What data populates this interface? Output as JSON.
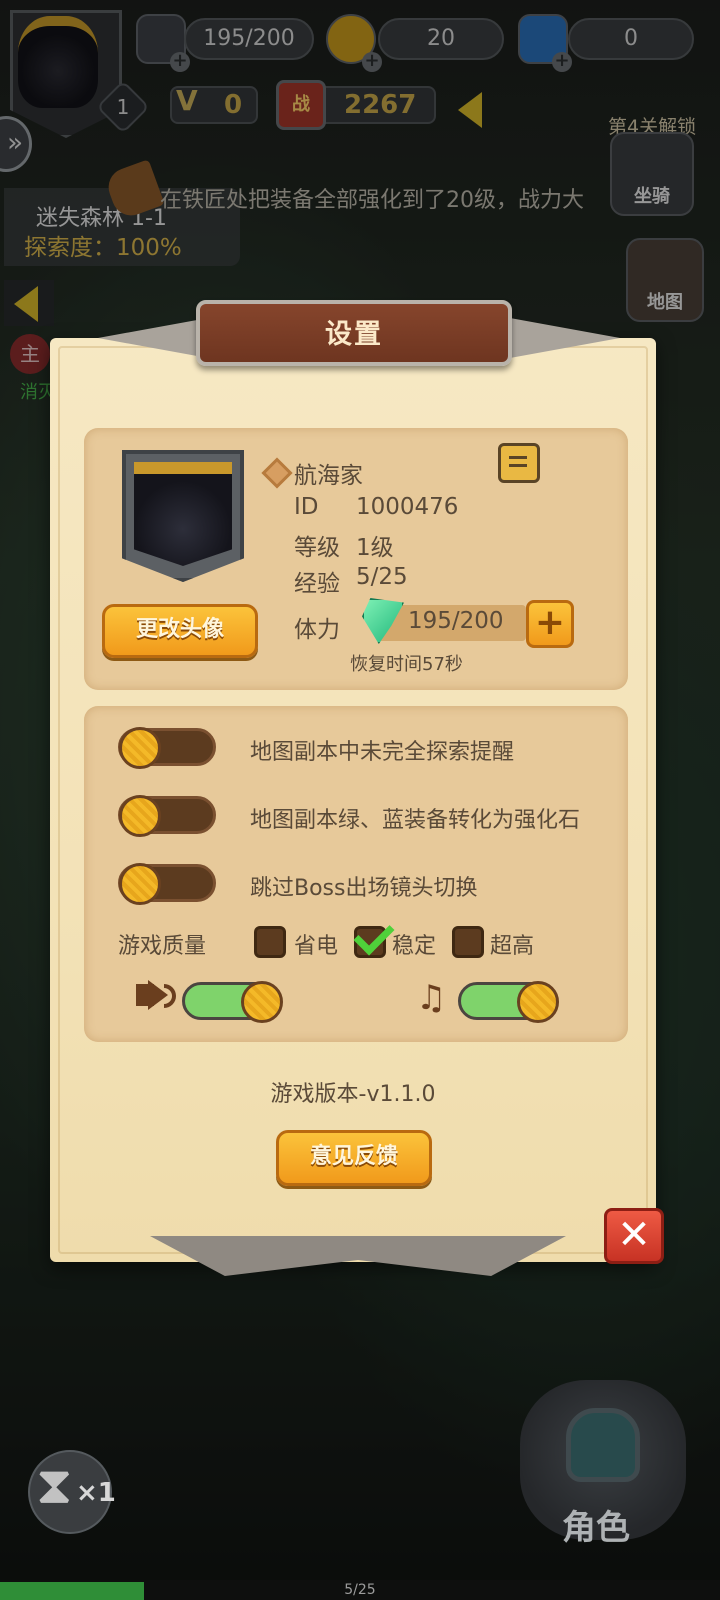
{
  "hud": {
    "player_level": "1",
    "stamina": "195/200",
    "gold": "20",
    "diamonds": "0",
    "vip": "0",
    "battle_label": "战",
    "power": "2267"
  },
  "side": {
    "unlock_hint": "第4关解锁",
    "mount_label": "坐骑",
    "map_label": "地图"
  },
  "area": {
    "name": "迷失森林 1-1",
    "explore": "探索度：100%"
  },
  "ticker": "在铁匠处把装备全部强化到了20级，战力大",
  "quest": {
    "badge": "主",
    "sub": "消灭"
  },
  "settings": {
    "title": "设置",
    "profile": {
      "name": "航海家",
      "id_label": "ID",
      "id_value": "1000476",
      "level_label": "等级",
      "level_value": "1级",
      "exp_label": "经验",
      "exp_value": "5/25",
      "stamina_label": "体力",
      "stamina_value": "195/200",
      "recover_text": "恢复时间57秒",
      "change_avatar": "更改头像",
      "plus": "+"
    },
    "options": [
      {
        "label": "地图副本中未完全探索提醒",
        "on": false
      },
      {
        "label": "地图副本绿、蓝装备转化为强化石",
        "on": false
      },
      {
        "label": "跳过Boss出场镜头切换",
        "on": false
      }
    ],
    "quality": {
      "label": "游戏质量",
      "choices": [
        "省电",
        "稳定",
        "超高"
      ],
      "selected": "稳定"
    },
    "sound_on": true,
    "music_on": true,
    "version": "游戏版本-v1.1.0",
    "feedback": "意见反馈",
    "close": "✕"
  },
  "bottom": {
    "speed": "×1",
    "role": "角色",
    "page": "5/25"
  }
}
